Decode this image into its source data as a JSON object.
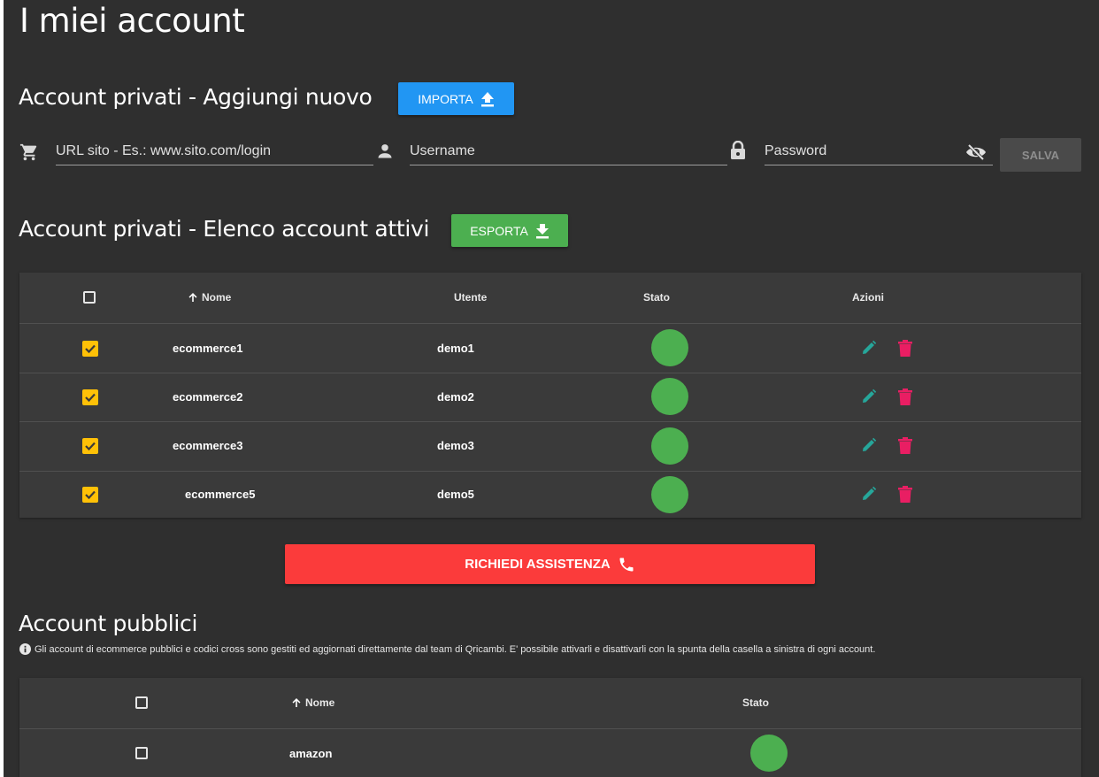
{
  "page": {
    "title": "I miei account"
  },
  "private_add": {
    "title": "Account privati - Aggiungi nuovo",
    "import_label": "IMPORTA",
    "url_placeholder": "URL sito - Es.: www.sito.com/login",
    "username_placeholder": "Username",
    "password_placeholder": "Password",
    "save_label": "SALVA"
  },
  "private_list": {
    "title": "Account privati - Elenco account attivi",
    "export_label": "ESPORTA",
    "columns": {
      "name": "Nome",
      "user": "Utente",
      "status": "Stato",
      "actions": "Azioni"
    },
    "rows": [
      {
        "name": "ecommerce1",
        "user": "demo1"
      },
      {
        "name": "ecommerce2",
        "user": "demo2"
      },
      {
        "name": "ecommerce3",
        "user": "demo3"
      },
      {
        "name": "ecommerce5",
        "user": "demo5"
      }
    ]
  },
  "assist": {
    "label": "RICHIEDI ASSISTENZA"
  },
  "public": {
    "title": "Account pubblici",
    "info": "Gli account di ecommerce pubblici e codici cross sono gestiti ed aggiornati direttamente dal team di Qricambi. E' possibile attivarli e disattivarli con la spunta della casella a sinistra di ogni account.",
    "columns": {
      "name": "Nome",
      "status": "Stato"
    },
    "rows": [
      {
        "name": "amazon"
      }
    ]
  },
  "colors": {
    "background": "#2f2f2f",
    "table": "#3a3a3a",
    "blue": "#2196f3",
    "green": "#4caf50",
    "red": "#fb3b3b",
    "checkbox": "#ffc107",
    "edit": "#26a69a",
    "delete": "#e91e63"
  }
}
